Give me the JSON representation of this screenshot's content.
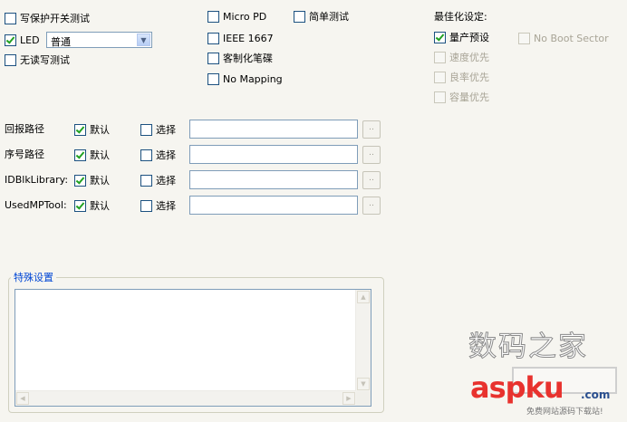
{
  "left_options": {
    "write_protect_test": "写保护开关测试",
    "led": "LED",
    "led_mode": "普通",
    "no_rw_test": "无读写测试"
  },
  "mid_options": {
    "micro_pd": "Micro PD",
    "ieee_1667": "IEEE 1667",
    "custom_disk": "客制化笔碟",
    "no_mapping": "No Mapping",
    "simple_test": "简单测试"
  },
  "optimize": {
    "title": "最佳化设定:",
    "production_preset": "量产预设",
    "speed_priority": "速度优先",
    "yield_priority": "良率优先",
    "capacity_priority": "容量优先",
    "no_boot_sector": "No Boot Sector"
  },
  "paths": {
    "default_label": "默认",
    "select_label": "选择",
    "browse_label": "..",
    "rows": [
      {
        "label": "回报路径"
      },
      {
        "label": "序号路径"
      },
      {
        "label": "IDBlkLibrary:"
      },
      {
        "label": "UsedMPTool:"
      }
    ]
  },
  "special": {
    "title": "特殊设置",
    "value": ""
  },
  "watermark": {
    "line1": "数码之家",
    "line2": "aspku",
    "line3": "免费网站源码下载站!",
    "line4": ".com"
  },
  "colors": {
    "background": "#f6f5f0",
    "check_green": "#21a121",
    "group_title": "#0046d5",
    "watermark_red": "#e8322e"
  }
}
